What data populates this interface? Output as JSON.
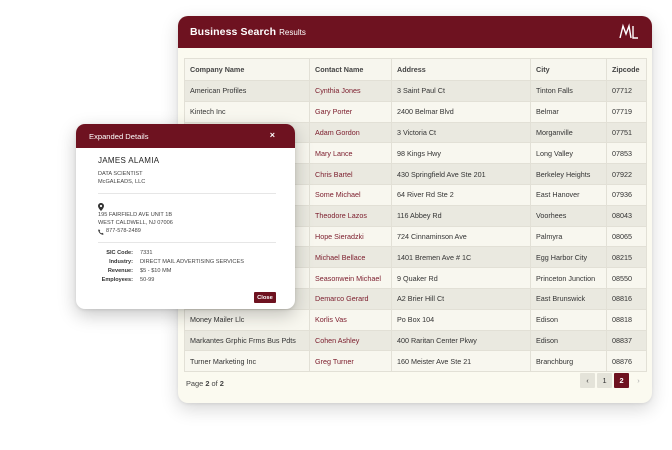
{
  "results": {
    "title": "Business Search",
    "subtitle": "Results",
    "logo_text": "ML",
    "columns": [
      "Company Name",
      "Contact Name",
      "Address",
      "City",
      "Zipcode"
    ],
    "rows": [
      [
        "American Profiles",
        "Cynthia Jones",
        "3 Saint Paul Ct",
        "Tinton Falls",
        "07712"
      ],
      [
        "Kintech Inc",
        "Gary Porter",
        "2400 Belmar Blvd",
        "Belmar",
        "07719"
      ],
      [
        "",
        "Adam Gordon",
        "3 Victoria Ct",
        "Morganville",
        "07751"
      ],
      [
        "",
        "Mary Lance",
        "98 Kings Hwy",
        "Long Valley",
        "07853"
      ],
      [
        "",
        "Chris Bartel",
        "430 Springfield Ave Ste 201",
        "Berkeley Heights",
        "07922"
      ],
      [
        "",
        "Some Michael",
        "64 River Rd Ste 2",
        "East Hanover",
        "07936"
      ],
      [
        "",
        "Theodore Lazos",
        "116 Abbey Rd",
        "Voorhees",
        "08043"
      ],
      [
        "",
        "Hope Sieradzki",
        "724 Cinnaminson Ave",
        "Palmyra",
        "08065"
      ],
      [
        "",
        "Michael Bellace",
        "1401 Bremen Ave # 1C",
        "Egg Harbor City",
        "08215"
      ],
      [
        "",
        "Seasonwein Michael",
        "9 Quaker Rd",
        "Princeton Junction",
        "08550"
      ],
      [
        "",
        "Demarco Gerard",
        "A2 Brier Hill Ct",
        "East Brunswick",
        "08816"
      ],
      [
        "Money Mailer Llc",
        "Korlis Vas",
        "Po Box 104",
        "Edison",
        "08818"
      ],
      [
        "Markantes Grphic Frms Bus Pdts",
        "Cohen Ashley",
        "400 Raritan Center Pkwy",
        "Edison",
        "08837"
      ],
      [
        "Turner Marketing Inc",
        "Greg Turner",
        "160 Meister Ave Ste 21",
        "Branchburg",
        "08876"
      ]
    ],
    "pagination": {
      "prefix": "Page",
      "current": "2",
      "of_label": "of",
      "total": "2",
      "prev_icon": "‹",
      "next_icon": "›",
      "pages": [
        "1",
        "2"
      ]
    }
  },
  "details": {
    "title": "Expanded Details",
    "close_icon": "×",
    "name": "JAMES ALAMIA",
    "job_title": "DATA SCIENTIST",
    "company": "McGALEADS, LLC",
    "address_line1": "195 FAIRFIELD AVE UNIT 1B",
    "address_line2": "WEST CALDWELL, NJ 07006",
    "phone": "877-578-2489",
    "fields": [
      {
        "label": "SIC Code:",
        "value": "7331"
      },
      {
        "label": "Industry:",
        "value": "DIRECT MAIL ADVERTISING SERVICES"
      },
      {
        "label": "Revenue:",
        "value": "$5 - $10 MM"
      },
      {
        "label": "Employees:",
        "value": "50-99"
      }
    ],
    "close_label": "Close"
  },
  "colors": {
    "brand": "#6e1220",
    "contact_link": "#7a1a2a"
  }
}
